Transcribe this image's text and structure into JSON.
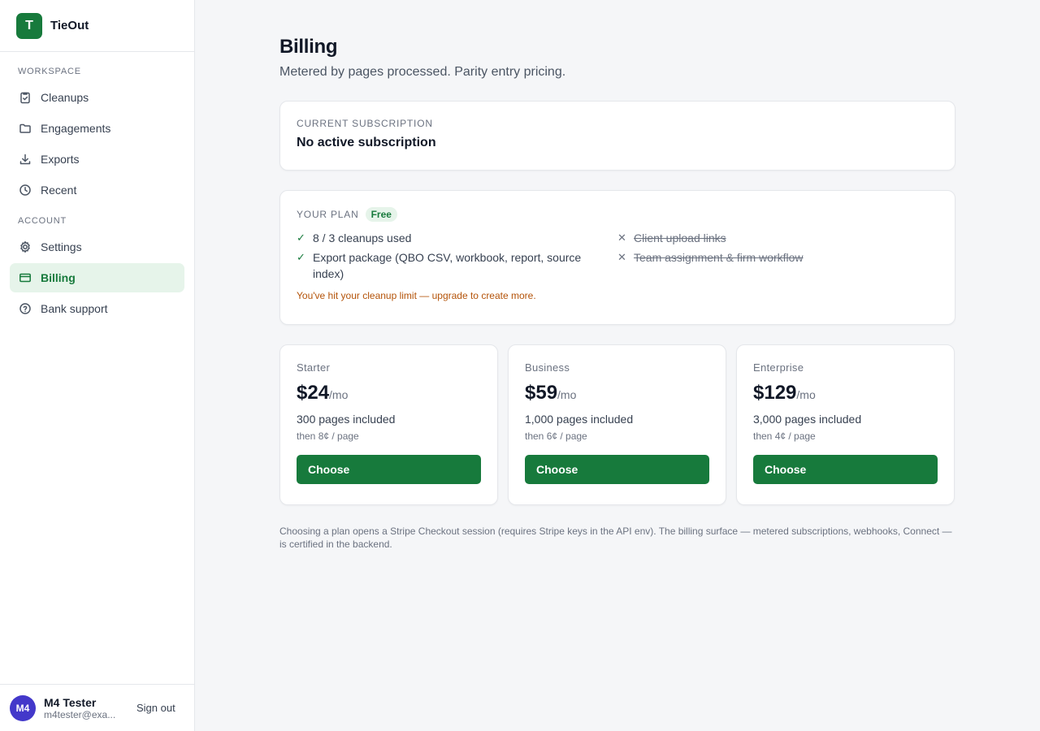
{
  "app": {
    "logo_letter": "T",
    "name": "TieOut"
  },
  "sidebar": {
    "workspace_heading": "WORKSPACE",
    "workspace_items": [
      {
        "label": "Cleanups",
        "icon": "clipboard-check-icon"
      },
      {
        "label": "Engagements",
        "icon": "folder-icon"
      },
      {
        "label": "Exports",
        "icon": "download-icon"
      },
      {
        "label": "Recent",
        "icon": "clock-icon"
      }
    ],
    "account_heading": "ACCOUNT",
    "account_items": [
      {
        "label": "Settings",
        "icon": "gear-icon"
      },
      {
        "label": "Billing",
        "icon": "credit-card-icon",
        "active": true
      },
      {
        "label": "Bank support",
        "icon": "help-circle-icon"
      }
    ]
  },
  "user": {
    "initials": "M4",
    "name": "M4 Tester",
    "email": "m4tester@exa...",
    "signout_label": "Sign out"
  },
  "page": {
    "title": "Billing",
    "subtitle": "Metered by pages processed. Parity entry pricing."
  },
  "subscription": {
    "heading": "CURRENT SUBSCRIPTION",
    "value": "No active subscription"
  },
  "plan": {
    "heading": "YOUR PLAN",
    "badge": "Free",
    "included": [
      "8 / 3 cleanups used",
      "Export package (QBO CSV, workbook, report, source index)"
    ],
    "excluded": [
      "Client upload links",
      "Team assignment & firm workflow"
    ],
    "limit_note": "You've hit your cleanup limit — upgrade to create more."
  },
  "tiers": [
    {
      "name": "Starter",
      "price": "$24",
      "period": "/mo",
      "pages": "300 pages included",
      "overage": "then 8¢ / page",
      "button": "Choose"
    },
    {
      "name": "Business",
      "price": "$59",
      "period": "/mo",
      "pages": "1,000 pages included",
      "overage": "then 6¢ / page",
      "button": "Choose"
    },
    {
      "name": "Enterprise",
      "price": "$129",
      "period": "/mo",
      "pages": "3,000 pages included",
      "overage": "then 4¢ / page",
      "button": "Choose"
    }
  ],
  "footnote": "Choosing a plan opens a Stripe Checkout session (requires Stripe keys in the API env). The billing surface — metered subscriptions, webhooks, Connect — is certified in the backend.",
  "colors": {
    "brand": "#177a3c",
    "brand_soft": "#e6f4ea",
    "warning": "#b45309",
    "avatar": "#4338ca"
  }
}
